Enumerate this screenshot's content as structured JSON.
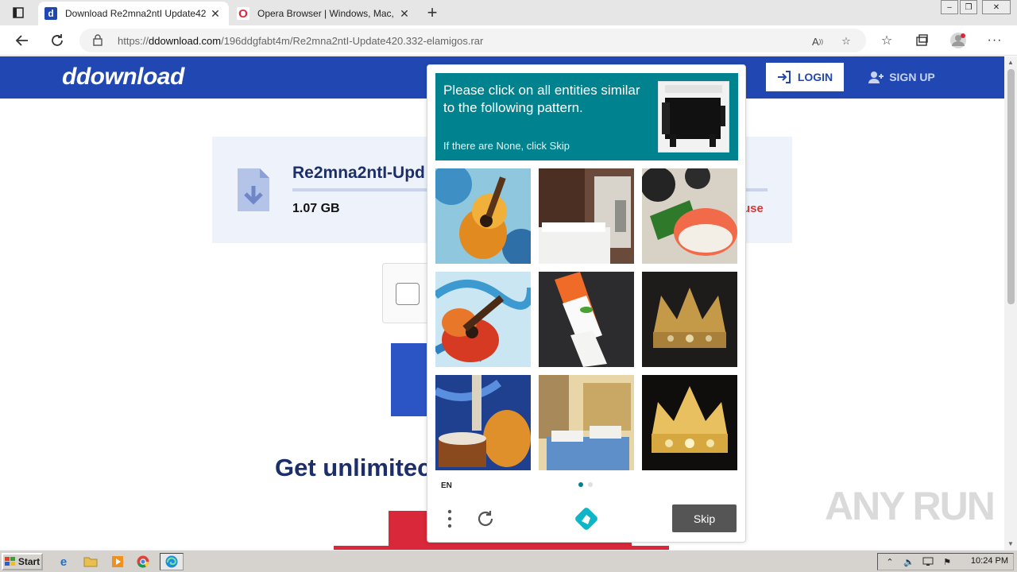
{
  "browser": {
    "tabs": [
      {
        "title": "Download Re2mna2ntI Update42",
        "favicon": "d",
        "active": true
      },
      {
        "title": "Opera Browser | Windows, Mac, L",
        "favicon": "O",
        "active": false
      }
    ],
    "url_domain": "ddownload.com",
    "url_prefix": "https://",
    "url_path": "/196ddgfabt4m/Re2mna2ntI-Update420.332-elamigos.rar",
    "colors": {
      "tabstrip": "#e6e6e6",
      "ddownload_favicon": "#2148b2",
      "opera_favicon": "#e0263a"
    }
  },
  "site": {
    "logo": "ddownload",
    "login_label": "LOGIN",
    "signup_label": "SIGN UP",
    "file_name": "Re2mna2ntI-Upd",
    "file_size": "1.07 GB",
    "abuse_label": "use",
    "promo_text": "Get unlimitec",
    "colors": {
      "brand": "#2148b2",
      "accent_red": "#d9283a",
      "title": "#1d2f6b"
    }
  },
  "challenge": {
    "prompt_line": "Please click on all entities similar to the following pattern.",
    "prompt_sub": "If there are None, click Skip",
    "tiles": [
      {
        "subject": "guitar-painting"
      },
      {
        "subject": "hotel-room"
      },
      {
        "subject": "sushi"
      },
      {
        "subject": "guitar-painting"
      },
      {
        "subject": "sushi"
      },
      {
        "subject": "crown"
      },
      {
        "subject": "guitar-painting"
      },
      {
        "subject": "hotel-room"
      },
      {
        "subject": "crown"
      }
    ],
    "language": "EN",
    "skip_label": "Skip",
    "page_dots": 2,
    "active_dot": 0,
    "colors": {
      "prompt_bg": "#00838f",
      "skip_bg": "#555555"
    }
  },
  "watermark": "ANY RUN",
  "taskbar": {
    "start_label": "Start",
    "clock": "10:24 PM"
  }
}
